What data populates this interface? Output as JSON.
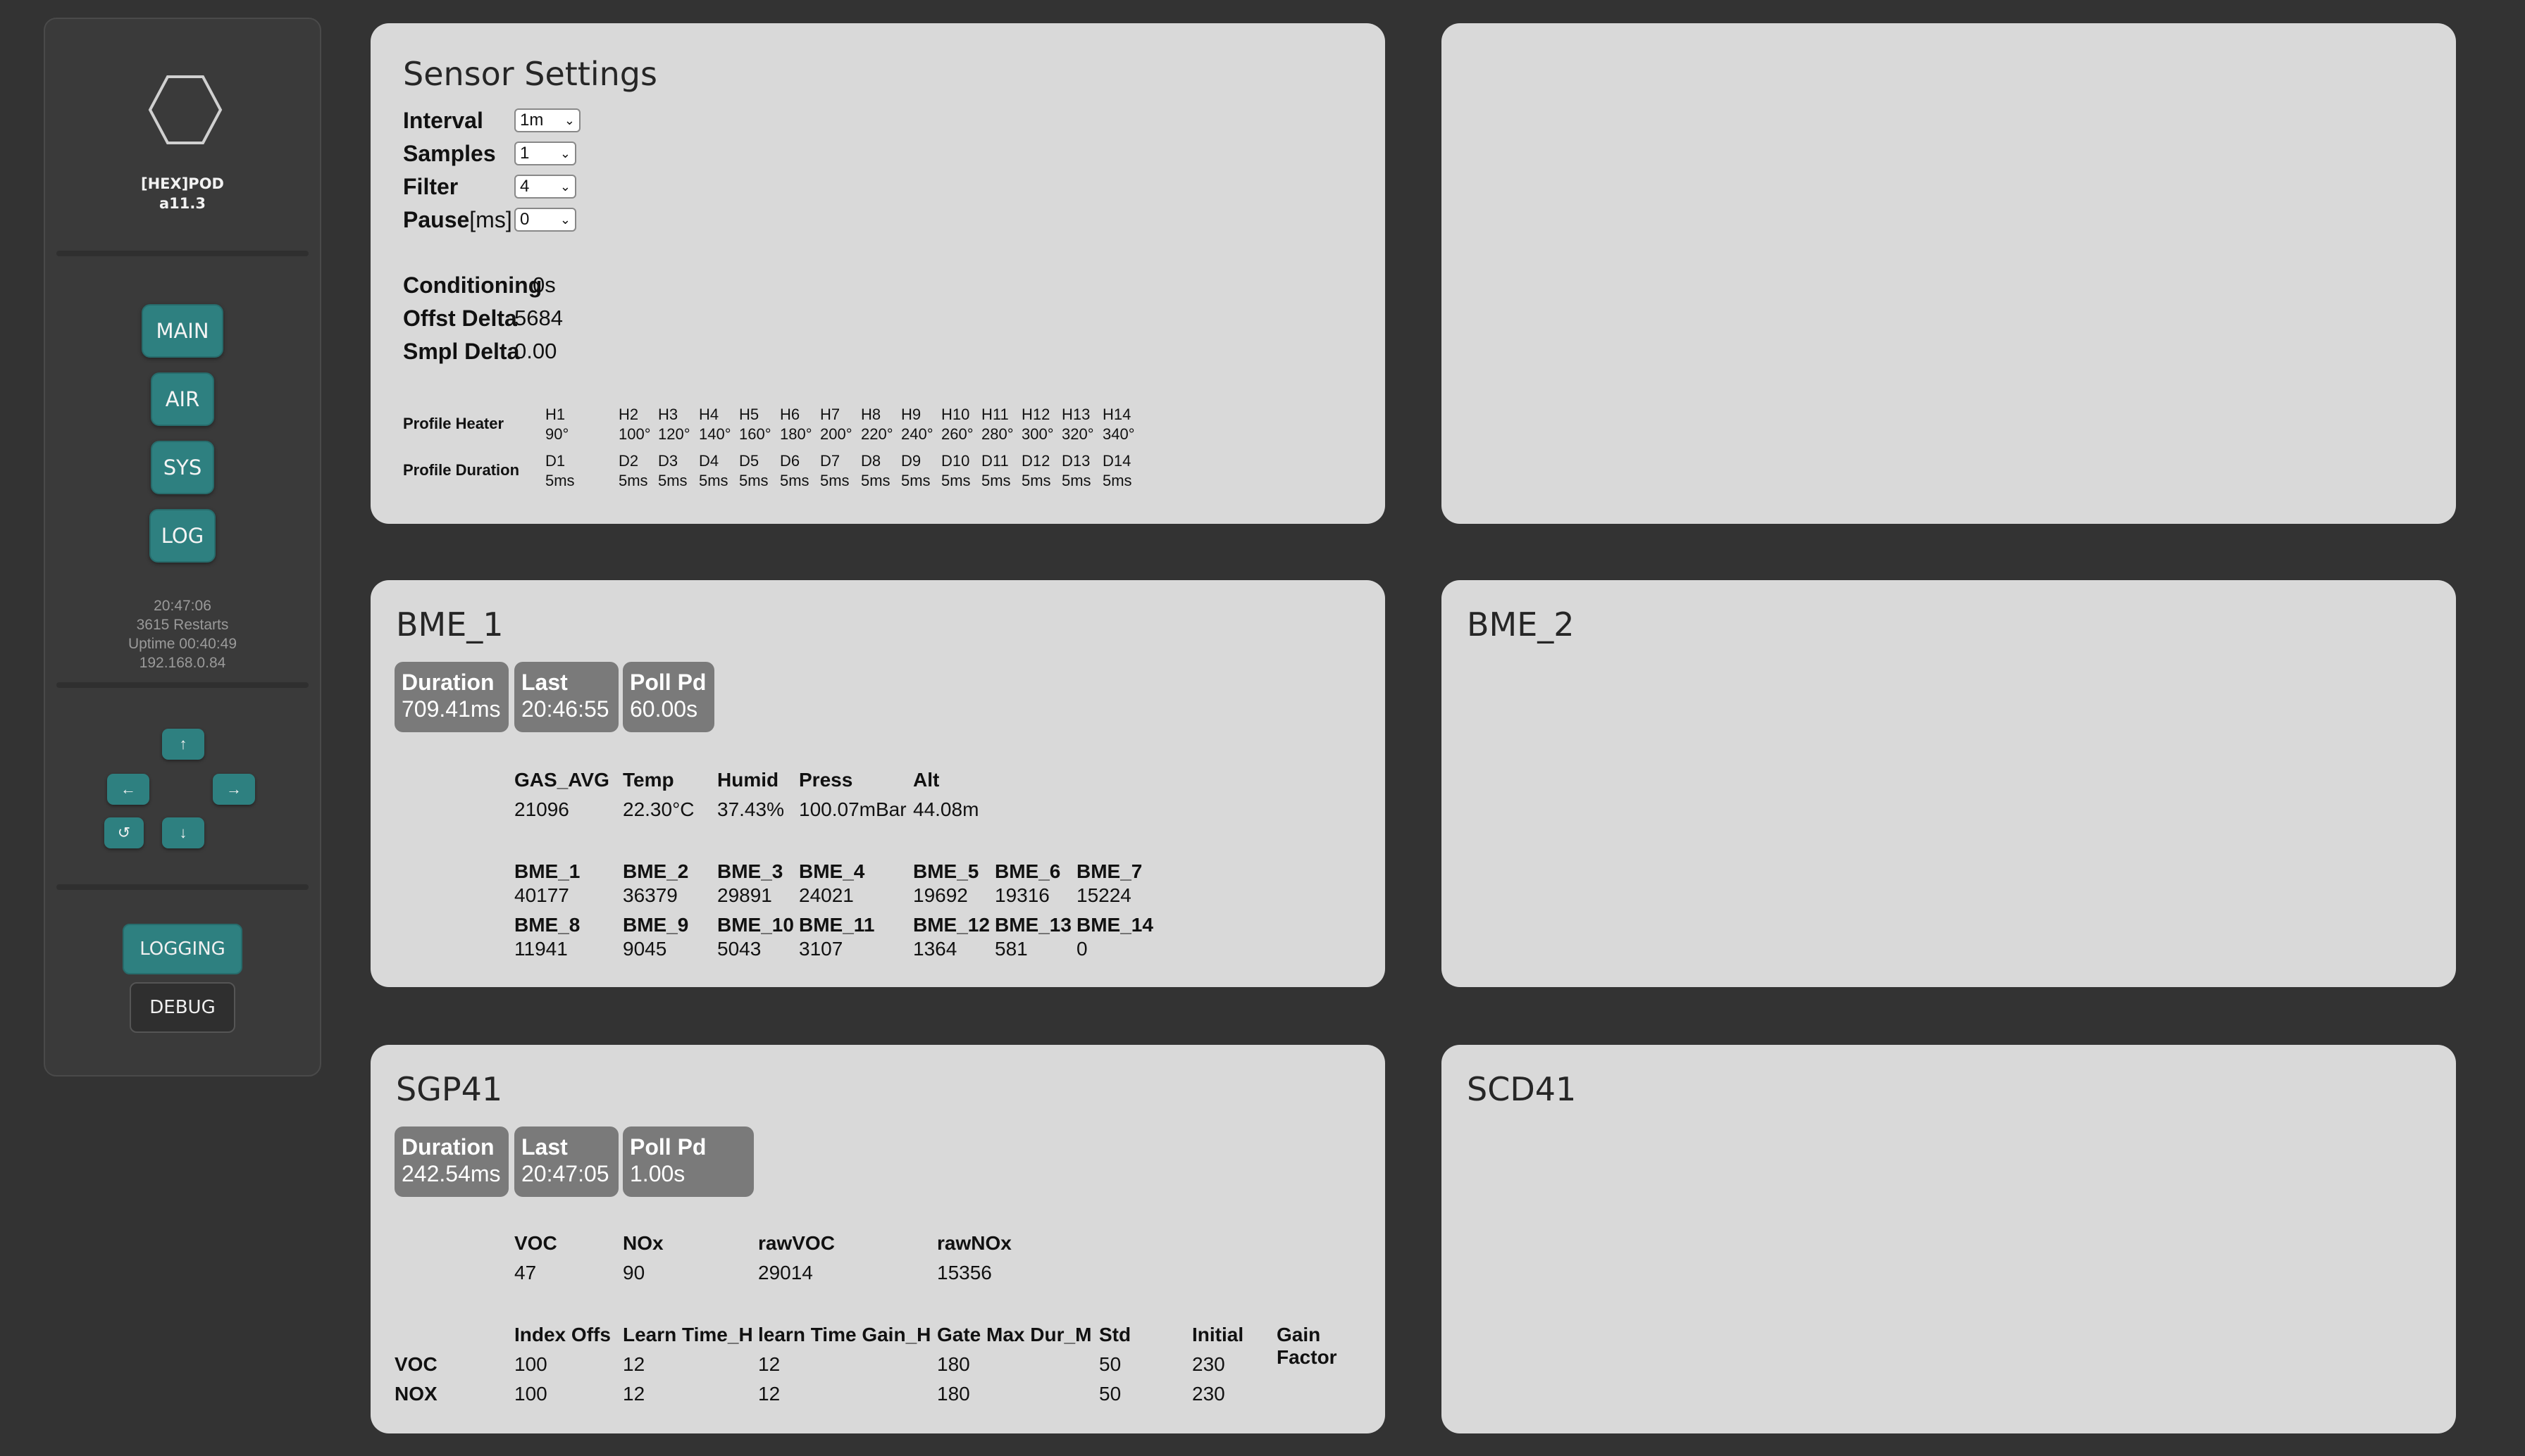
{
  "sidebar": {
    "brand": "[HEX]POD",
    "version": "a11.3",
    "nav": [
      "MAIN",
      "AIR",
      "SYS",
      "LOG"
    ],
    "info": {
      "time": "20:47:06",
      "restarts": "3615 Restarts",
      "uptime": "Uptime 00:40:49",
      "ip": "192.168.0.84"
    },
    "arrows": {
      "up": "↑",
      "left": "←",
      "right": "→",
      "reset": "↺",
      "down": "↓"
    },
    "logging": "LOGGING",
    "debug": "DEBUG"
  },
  "settings": {
    "title": "Sensor Settings",
    "interval": {
      "label": "Interval",
      "value": "1m"
    },
    "samples": {
      "label": "Samples",
      "value": "1"
    },
    "filter": {
      "label": "Filter",
      "value": "4"
    },
    "pause": {
      "label": "Pause",
      "unit": "[ms]",
      "value": "0"
    },
    "conditioning": {
      "label": "Conditioning",
      "value": "0s"
    },
    "offset_delta": {
      "label": "Offst Delta",
      "value": "5684"
    },
    "sample_delta": {
      "label": "Smpl Delta",
      "value": "0.00"
    },
    "profile_heater_label": "Profile Heater",
    "profile_duration_label": "Profile Duration",
    "heaters": [
      {
        "h": "H1",
        "v": "90°"
      },
      {
        "h": "H2",
        "v": "100°"
      },
      {
        "h": "H3",
        "v": "120°"
      },
      {
        "h": "H4",
        "v": "140°"
      },
      {
        "h": "H5",
        "v": "160°"
      },
      {
        "h": "H6",
        "v": "180°"
      },
      {
        "h": "H7",
        "v": "200°"
      },
      {
        "h": "H8",
        "v": "220°"
      },
      {
        "h": "H9",
        "v": "240°"
      },
      {
        "h": "H10",
        "v": "260°"
      },
      {
        "h": "H11",
        "v": "280°"
      },
      {
        "h": "H12",
        "v": "300°"
      },
      {
        "h": "H13",
        "v": "320°"
      },
      {
        "h": "H14",
        "v": "340°"
      }
    ],
    "durations": [
      {
        "h": "D1",
        "v": "5ms"
      },
      {
        "h": "D2",
        "v": "5ms"
      },
      {
        "h": "D3",
        "v": "5ms"
      },
      {
        "h": "D4",
        "v": "5ms"
      },
      {
        "h": "D5",
        "v": "5ms"
      },
      {
        "h": "D6",
        "v": "5ms"
      },
      {
        "h": "D7",
        "v": "5ms"
      },
      {
        "h": "D8",
        "v": "5ms"
      },
      {
        "h": "D9",
        "v": "5ms"
      },
      {
        "h": "D10",
        "v": "5ms"
      },
      {
        "h": "D11",
        "v": "5ms"
      },
      {
        "h": "D12",
        "v": "5ms"
      },
      {
        "h": "D13",
        "v": "5ms"
      },
      {
        "h": "D14",
        "v": "5ms"
      }
    ]
  },
  "bme1": {
    "title": "BME_1",
    "duration": {
      "label": "Duration",
      "value": "709.41ms"
    },
    "last": {
      "label": "Last",
      "value": "20:46:55"
    },
    "poll": {
      "label": "Poll Pd",
      "value": "60.00s"
    },
    "main_headers": [
      "GAS_AVG",
      "Temp",
      "Humid",
      "Press",
      "Alt"
    ],
    "main_values": [
      "21096",
      "22.30°C",
      "37.43%",
      "100.07mBar",
      "44.08m"
    ],
    "row1_headers": [
      "BME_1",
      "BME_2",
      "BME_3",
      "BME_4",
      "BME_5",
      "BME_6",
      "BME_7"
    ],
    "row1_values": [
      "40177",
      "36379",
      "29891",
      "24021",
      "19692",
      "19316",
      "15224"
    ],
    "row2_headers": [
      "BME_8",
      "BME_9",
      "BME_10",
      "BME_11",
      "BME_12",
      "BME_13",
      "BME_14"
    ],
    "row2_values": [
      "11941",
      "9045",
      "5043",
      "3107",
      "1364",
      "581",
      "0"
    ]
  },
  "bme2": {
    "title": "BME_2"
  },
  "sgp41": {
    "title": "SGP41",
    "duration": {
      "label": "Duration",
      "value": "242.54ms"
    },
    "last": {
      "label": "Last",
      "value": "20:47:05"
    },
    "poll": {
      "label": "Poll Pd",
      "value": "1.00s"
    },
    "main_headers": [
      "VOC",
      "NOx",
      "rawVOC",
      "rawNOx"
    ],
    "main_values": [
      "47",
      "90",
      "29014",
      "15356"
    ],
    "param_headers": [
      "Index Offs",
      "Learn Time_H",
      "learn Time Gain_H",
      "Gate Max Dur_M",
      "Std",
      "Initial",
      "Gain Factor"
    ],
    "rows": [
      {
        "label": "VOC",
        "values": [
          "100",
          "12",
          "12",
          "180",
          "50",
          "230"
        ]
      },
      {
        "label": "NOX",
        "values": [
          "100",
          "12",
          "12",
          "180",
          "50",
          "230"
        ]
      }
    ]
  },
  "scd41": {
    "title": "SCD41"
  },
  "colors": {
    "background": "#333333",
    "panel": "#d9d9d9",
    "accent": "#2e8080",
    "badge": "#7a7a7a"
  }
}
